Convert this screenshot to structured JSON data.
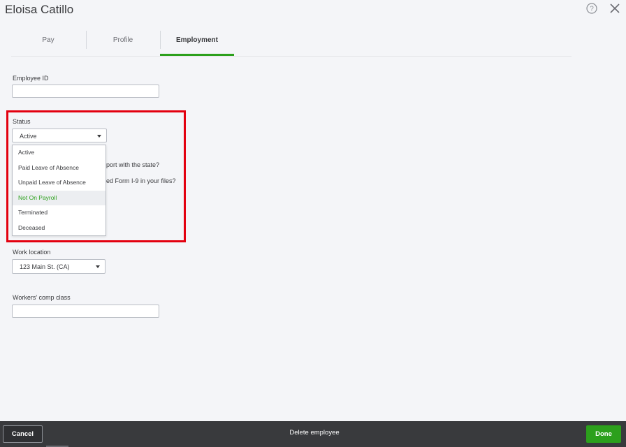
{
  "header": {
    "title": "Eloisa Catillo",
    "help_icon": "help-circle-icon",
    "close_icon": "close-icon"
  },
  "tabs": [
    {
      "label": "Pay",
      "active": false
    },
    {
      "label": "Profile",
      "active": false
    },
    {
      "label": "Employment",
      "active": true
    }
  ],
  "accent_color": "#2ca01c",
  "highlight_color": "#e3000f",
  "form": {
    "employee_id": {
      "label": "Employee ID",
      "value": ""
    },
    "status": {
      "label": "Status",
      "value": "Active",
      "options": [
        "Active",
        "Paid Leave of Absence",
        "Unpaid Leave of Absence",
        "Not On Payroll",
        "Terminated",
        "Deceased"
      ],
      "hovered_option": "Not On Payroll"
    },
    "obscured_question_1": "port with the state?",
    "obscured_question_2": "ed Form I-9 in your files?",
    "work_location": {
      "label": "Work location",
      "value": "123 Main St. (CA)"
    },
    "workers_comp": {
      "label": "Workers' comp class",
      "value": ""
    }
  },
  "footer": {
    "cancel_label": "Cancel",
    "delete_label": "Delete employee",
    "done_label": "Done"
  }
}
